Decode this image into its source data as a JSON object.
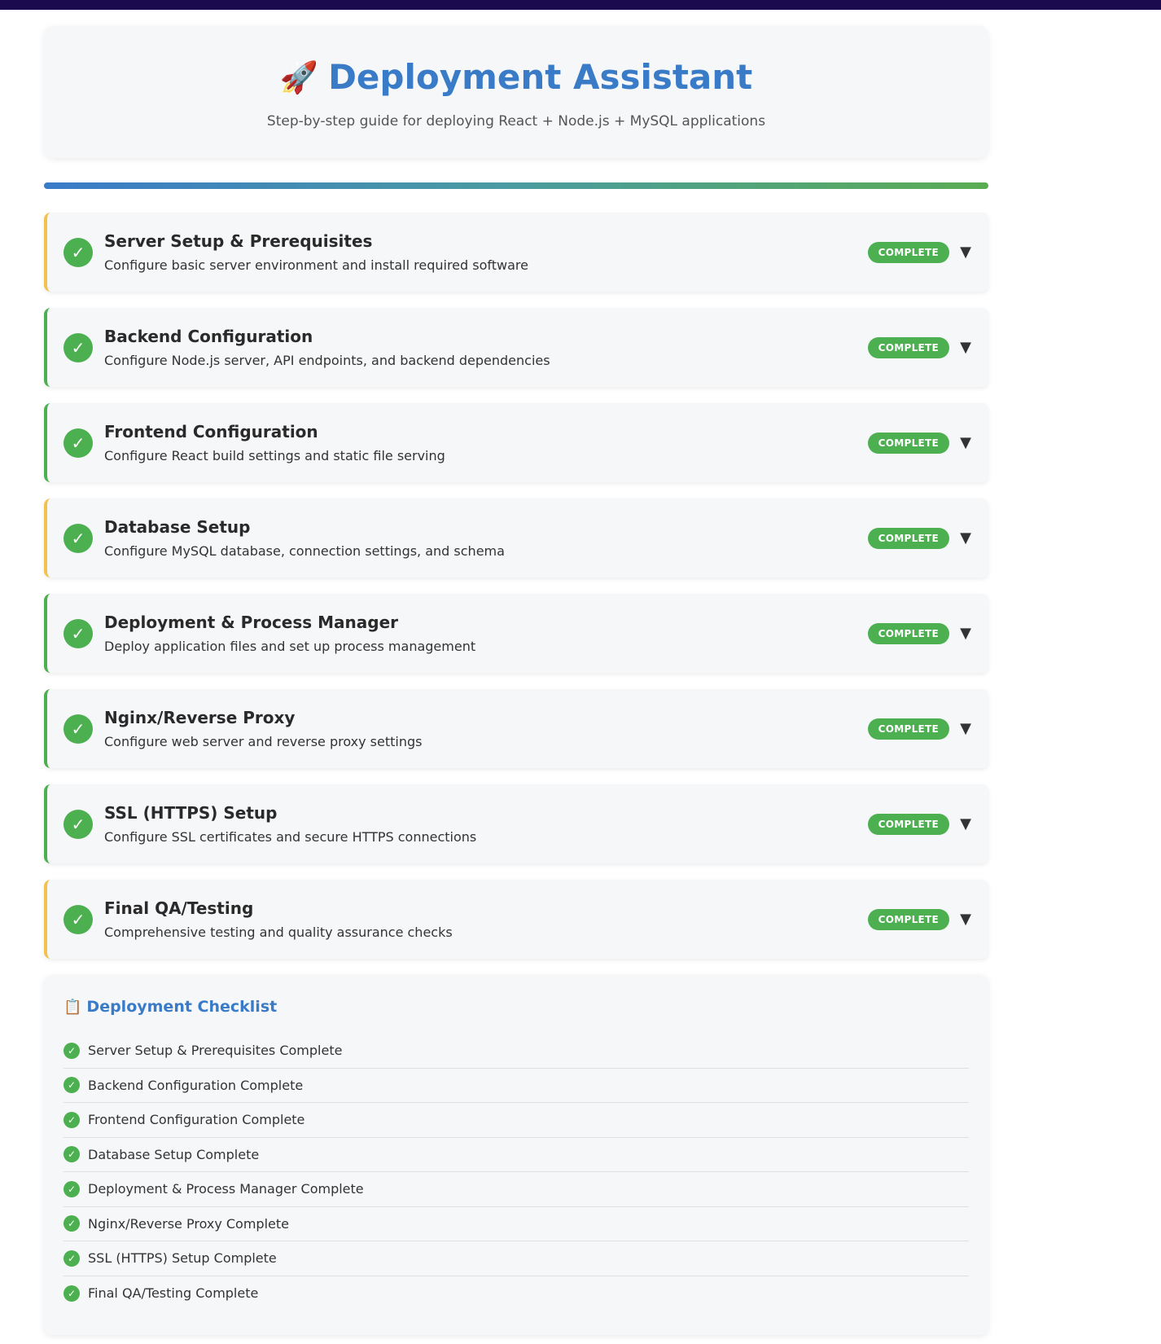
{
  "header": {
    "icon": "rocket-icon",
    "icon_glyph": "🚀",
    "title": "Deployment Assistant",
    "subtitle": "Step-by-step guide for deploying React + Node.js + MySQL applications"
  },
  "progress": {
    "value": 1.0
  },
  "colors": {
    "accent": "#3a7bc8",
    "success": "#4caf50",
    "warning": "#f2c14e",
    "top_bar": "#1b0a4d"
  },
  "steps": [
    {
      "title": "Server Setup & Prerequisites",
      "description": "Configure basic server environment and install required software",
      "status": "COMPLETE",
      "accent": "warning"
    },
    {
      "title": "Backend Configuration",
      "description": "Configure Node.js server, API endpoints, and backend dependencies",
      "status": "COMPLETE",
      "accent": "success"
    },
    {
      "title": "Frontend Configuration",
      "description": "Configure React build settings and static file serving",
      "status": "COMPLETE",
      "accent": "success"
    },
    {
      "title": "Database Setup",
      "description": "Configure MySQL database, connection settings, and schema",
      "status": "COMPLETE",
      "accent": "warning"
    },
    {
      "title": "Deployment & Process Manager",
      "description": "Deploy application files and set up process management",
      "status": "COMPLETE",
      "accent": "success"
    },
    {
      "title": "Nginx/Reverse Proxy",
      "description": "Configure web server and reverse proxy settings",
      "status": "COMPLETE",
      "accent": "success"
    },
    {
      "title": "SSL (HTTPS) Setup",
      "description": "Configure SSL certificates and secure HTTPS connections",
      "status": "COMPLETE",
      "accent": "success"
    },
    {
      "title": "Final QA/Testing",
      "description": "Comprehensive testing and quality assurance checks",
      "status": "COMPLETE",
      "accent": "warning"
    }
  ],
  "checklist": {
    "icon": "clipboard-icon",
    "icon_glyph": "📋",
    "title": "Deployment Checklist",
    "items": [
      "Server Setup & Prerequisites Complete",
      "Backend Configuration Complete",
      "Frontend Configuration Complete",
      "Database Setup Complete",
      "Deployment & Process Manager Complete",
      "Nginx/Reverse Proxy Complete",
      "SSL (HTTPS) Setup Complete",
      "Final QA/Testing Complete"
    ]
  },
  "glyphs": {
    "check": "✓",
    "chevron": "▼"
  }
}
